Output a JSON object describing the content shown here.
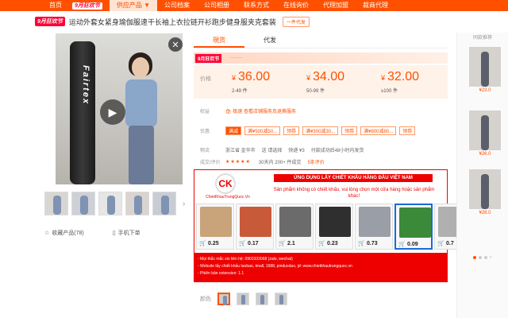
{
  "nav": {
    "items": [
      "首页",
      "供应产品 ▼",
      "公司档案",
      "公司相册",
      "联系方式",
      "在线询价",
      "代理加盟",
      "裁商代理"
    ],
    "badge": "9月狂欢节"
  },
  "product": {
    "badge": "9月狂欢节",
    "title": "运动外套女紧身瑜伽服速干长袖上衣拉链开衫跑步健身服夹克套装",
    "price_button": "一件代发"
  },
  "gallery": {
    "bag_text": "Fairtex",
    "play_icon": "▶",
    "close_icon": "✕",
    "arrow": "›",
    "favorite_label": "收藏产品(78)",
    "phone_label": "手机下单"
  },
  "tabs": [
    "現货",
    "代发"
  ],
  "promo": {
    "logo": "9月狂欢节",
    "text": "········"
  },
  "prices": {
    "label": "价格",
    "currency": "¥",
    "tiers": [
      {
        "value": "36.00",
        "range": "2-49 件"
      },
      {
        "value": "34.00",
        "range": "50-99 件"
      },
      {
        "value": "32.00",
        "range": "≥100 件"
      }
    ]
  },
  "rows": {
    "rights_label": "权益",
    "rights_text": "🛍 极速 查看店铺服务及退换服务",
    "coupon_label": "优惠",
    "coupons": [
      "满减",
      "满¥500减50...",
      "领券",
      "满¥300减30...",
      "领券",
      "满¥800减80...",
      "领券"
    ],
    "ship_label": "物流",
    "ship_from": "浙江省 金华市",
    "ship_to": "送 请选择",
    "ship_fee": "快递 ¥3",
    "ship_time": "付款成功后48小时内发货",
    "rate_label": "成交/评价",
    "stars": "★★★★★",
    "deals": "30天内 200+ 件成交",
    "reviews": "5条评价"
  },
  "ad": {
    "logo_mark": "CK",
    "brand": "ChietKhauTrungQuoc.Vn",
    "headline": "ỨNG DỤNG LẤY CHIẾT KHẤU HÀNG ĐẦU VIỆT NAM",
    "sub": "Sản phẩm không có chiết khấu, vui lòng chọn một cửa hàng hoặc sản phẩm khác!",
    "cart_icon": "🛒",
    "products": [
      {
        "price": "0.25",
        "color": "#c9a37a"
      },
      {
        "price": "0.17",
        "color": "#c85a3a"
      },
      {
        "price": "2.1",
        "color": "#6b6b6b"
      },
      {
        "price": "0.23",
        "color": "#2f2f2f"
      },
      {
        "price": "0.73",
        "color": "#9a9ea6"
      },
      {
        "price": "0.09",
        "color": "#3a8a3a"
      },
      {
        "price": "0.7",
        "color": "#b0b0b0"
      }
    ],
    "footer_lines": [
      "- Mọi thắc mắc xin liên hệ: 0903333068 (zalo, wechat)",
      "- Website lấy chiết khấu taobao, tmall, 1688, pinduoduo, jd: www.chietkhautrungquoc.vn",
      "- Phiên bản extension: 1.1"
    ]
  },
  "color_row": {
    "label": "颜色"
  },
  "right": {
    "title": "同款推荐",
    "prices": [
      "¥23.0",
      "¥26.0",
      "¥28.0"
    ],
    "nav": "›"
  }
}
